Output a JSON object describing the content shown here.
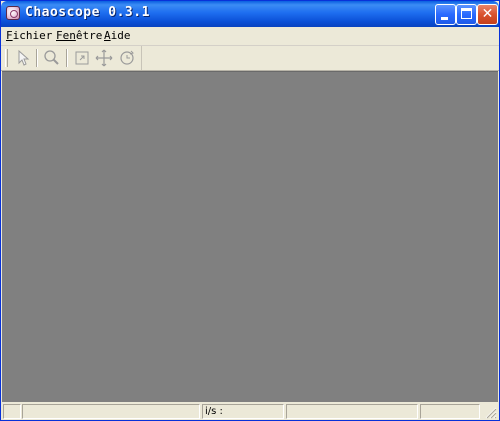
{
  "window": {
    "title": "Chaoscope 0.3.1",
    "controls": {
      "minimize_icon": "minimize-icon",
      "maximize_icon": "maximize-icon",
      "close_glyph": "✕"
    }
  },
  "menubar": {
    "items": [
      {
        "label_first": "F",
        "label_rest": "ichier"
      },
      {
        "label_first": "Fen",
        "label_rest": "être"
      },
      {
        "label_first": "A",
        "label_rest": "ide"
      }
    ]
  },
  "toolbar": {
    "tools": [
      {
        "icon": "pointer-icon"
      },
      {
        "icon": "zoom-icon"
      },
      {
        "icon": "fit-view-icon"
      },
      {
        "icon": "pan-icon"
      },
      {
        "icon": "rotate-icon"
      }
    ]
  },
  "canvas": {
    "color": "#808080"
  },
  "statusbar": {
    "panes": [
      "",
      "",
      "i/s :",
      "",
      ""
    ]
  },
  "colors": {
    "titlebar": "#0a4fd6",
    "chrome": "#ece9d8",
    "canvas": "#808080"
  }
}
